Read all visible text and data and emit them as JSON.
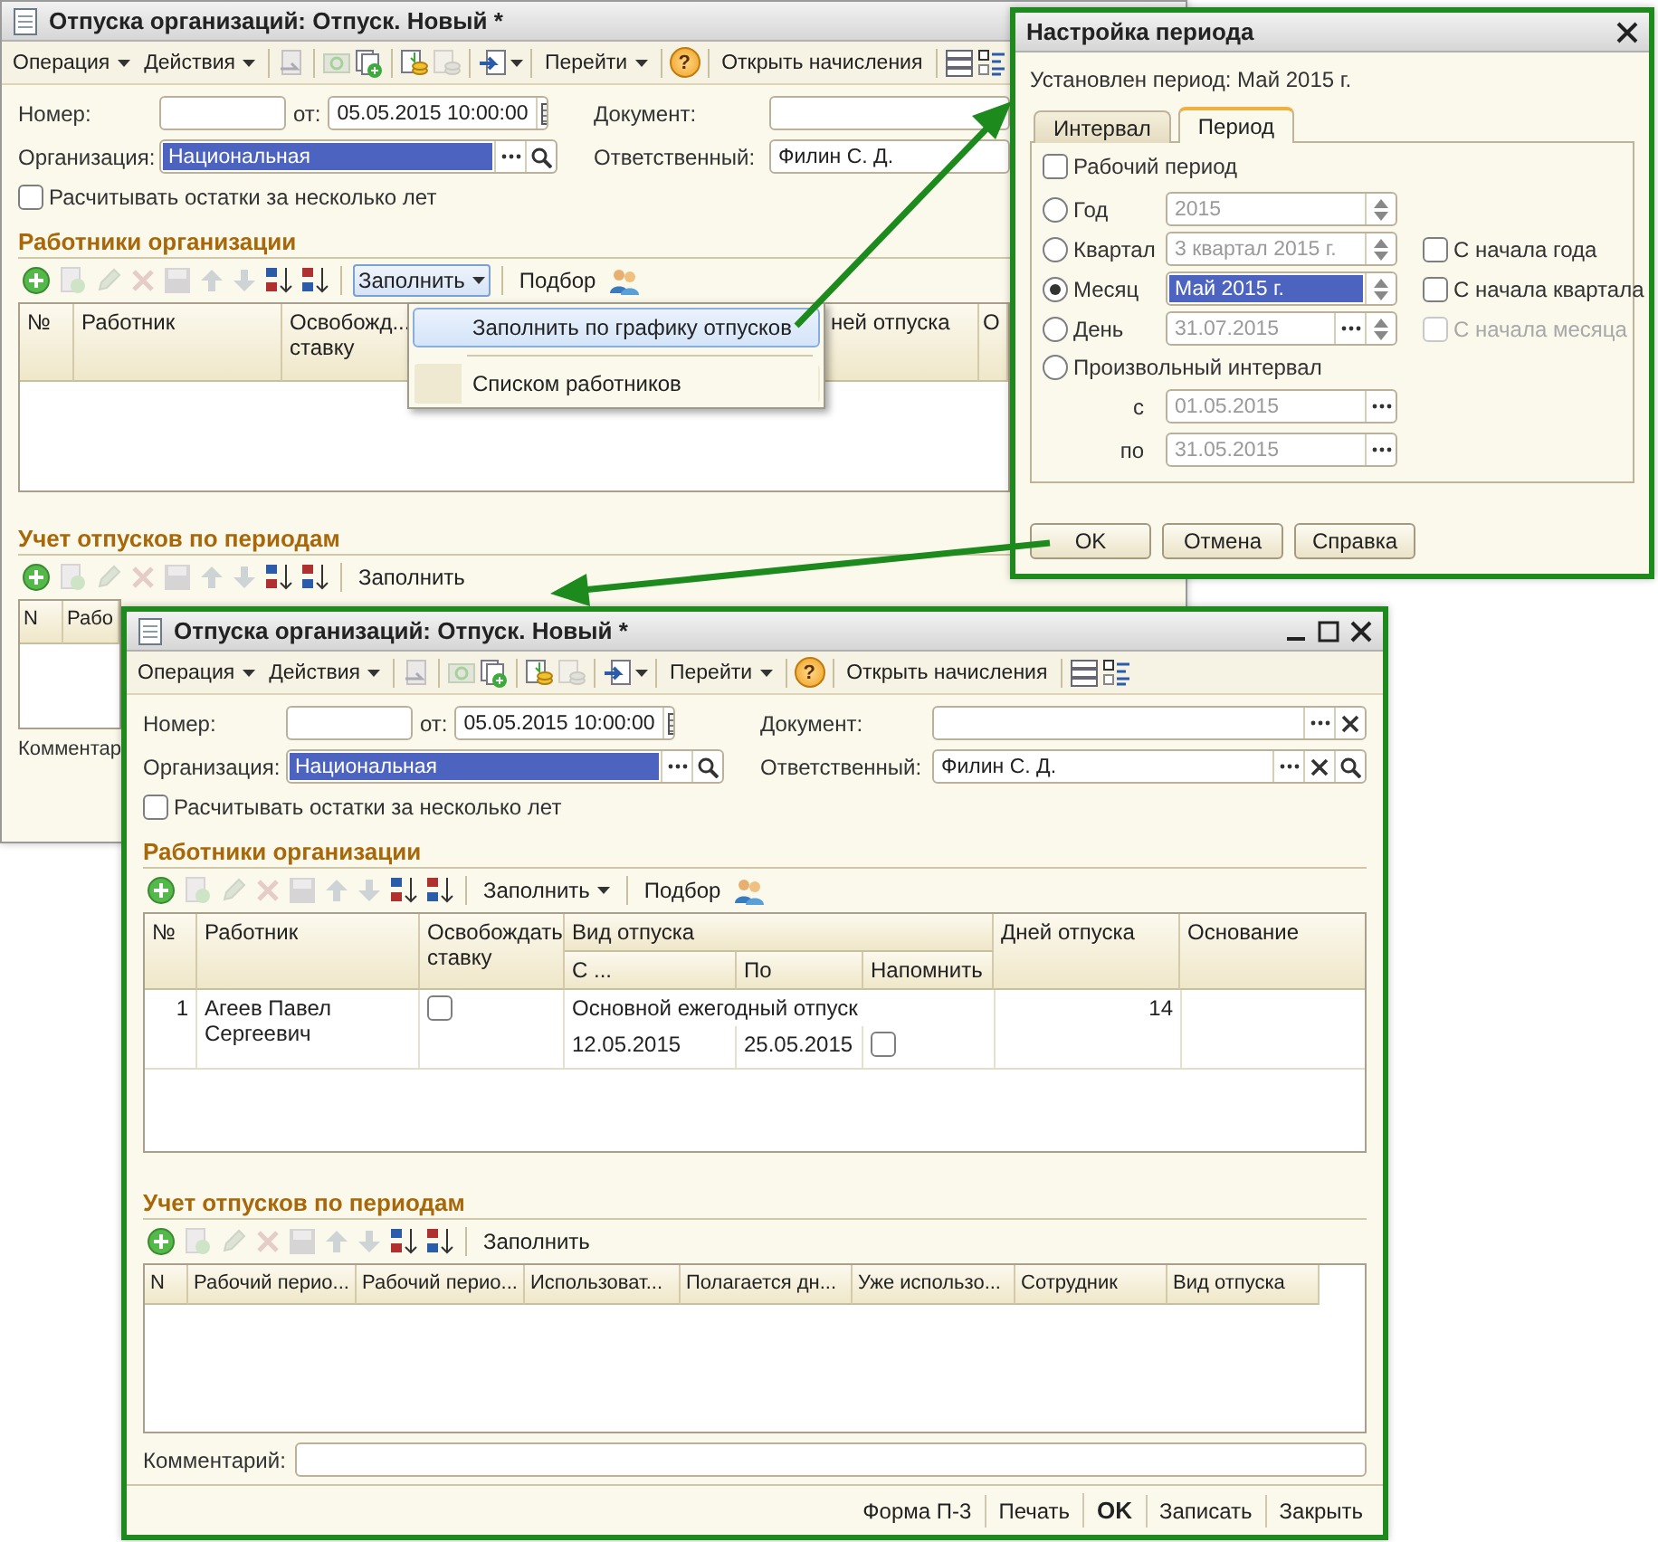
{
  "back_window": {
    "title": "Отпуска организаций: Отпуск. Новый *",
    "toolbar": {
      "operation": "Операция",
      "actions": "Действия",
      "goto": "Перейти",
      "help": "?",
      "open_accruals": "Открыть начисления"
    },
    "number_label": "Номер:",
    "date_label": "от:",
    "date_value": "05.05.2015 10:00:00",
    "document_label": "Документ:",
    "organization_label": "Организация:",
    "organization_value": "Национальная",
    "organization_selected": true,
    "responsible_label": "Ответственный:",
    "responsible_value": "Филин С. Д.",
    "recalc": {
      "label": "Расчитывать остатки за несколько лет",
      "checked": false
    },
    "workers": {
      "title": "Работники организации",
      "fill": {
        "label": "Заполнить",
        "expanded": true
      },
      "pick": "Подбор",
      "columns": [
        "№",
        "Работник",
        "Освобожд... ставку",
        "ней отпуска",
        "О"
      ],
      "menu": [
        {
          "label": "Заполнить по графику отпусков",
          "selected": true
        },
        {
          "label": "Списком работников",
          "selected": false
        }
      ]
    },
    "periods": {
      "title": "Учет отпусков по периодам",
      "fill": "Заполнить",
      "columns": [
        "N",
        "Рабо"
      ]
    },
    "comment_label": "Комментар"
  },
  "period_dialog": {
    "title": "Настройка периода",
    "period_text": "Установлен период: Май 2015 г.",
    "tabs": [
      {
        "label": "Интервал",
        "selected": false
      },
      {
        "label": "Период",
        "selected": true
      }
    ],
    "working_period": {
      "label": "Рабочий период",
      "checked": false
    },
    "options": [
      {
        "label": "Год",
        "selected": false,
        "value": "2015",
        "kind": "spinner"
      },
      {
        "label": "Квартал",
        "selected": false,
        "value": "3 квартал 2015 г.",
        "kind": "spinner",
        "side": {
          "label": "С начала года",
          "checked": false,
          "disabled": false
        }
      },
      {
        "label": "Месяц",
        "selected": true,
        "value": "Май 2015 г.",
        "kind": "spinner",
        "side": {
          "label": "С начала квартала",
          "checked": false,
          "disabled": false
        }
      },
      {
        "label": "День",
        "selected": false,
        "value": "31.07.2015",
        "kind": "picker_spinner",
        "side": {
          "label": "С начала месяца",
          "checked": false,
          "disabled": true
        }
      }
    ],
    "custom": {
      "label": "Произвольный интервал",
      "selected": false,
      "from_label": "с",
      "from_value": "01.05.2015",
      "to_label": "по",
      "to_value": "31.05.2015"
    },
    "buttons": [
      "OK",
      "Отмена",
      "Справка"
    ]
  },
  "front_window": {
    "title": "Отпуска организаций: Отпуск. Новый *",
    "toolbar": {
      "operation": "Операция",
      "actions": "Действия",
      "goto": "Перейти",
      "help": "?",
      "open_accruals": "Открыть начисления"
    },
    "number_label": "Номер:",
    "date_label": "от:",
    "date_value": "05.05.2015 10:00:00",
    "document_label": "Документ:",
    "organization_label": "Организация:",
    "organization_value": "Национальная",
    "organization_selected": true,
    "responsible_label": "Ответственный:",
    "responsible_value": "Филин С. Д.",
    "recalc": {
      "label": "Расчитывать остатки за несколько лет",
      "checked": false
    },
    "workers": {
      "title": "Работники организации",
      "fill": {
        "label": "Заполнить",
        "expanded": false
      },
      "pick": "Подбор",
      "columns": {
        "number": "№",
        "employee": "Работник",
        "release": "Освобождать ставку",
        "leave_type": "Вид отпуска",
        "from": "С ...",
        "to": "По",
        "remind": "Напомнить",
        "days": "Дней отпуска",
        "basis": "Основание"
      },
      "rows": [
        {
          "number": "1",
          "employee": "Агеев Павел Сергеевич",
          "release": false,
          "leave_type": "Основной ежегодный отпуск",
          "from": "12.05.2015",
          "to": "25.05.2015",
          "remind": false,
          "days": "14"
        }
      ]
    },
    "periods": {
      "title": "Учет отпусков по периодам",
      "fill": "Заполнить",
      "columns": [
        "N",
        "Рабочий перио...",
        "Рабочий перио...",
        "Использоват...",
        "Полагается дн...",
        "Уже использо...",
        "Сотрудник",
        "Вид отпуска"
      ]
    },
    "comment_label": "Комментарий:",
    "footer": [
      {
        "label": "Форма П-3",
        "default": false
      },
      {
        "label": "Печать",
        "default": false
      },
      {
        "label": "OK",
        "default": true
      },
      {
        "label": "Записать",
        "default": false
      },
      {
        "label": "Закрыть",
        "default": false
      }
    ]
  }
}
